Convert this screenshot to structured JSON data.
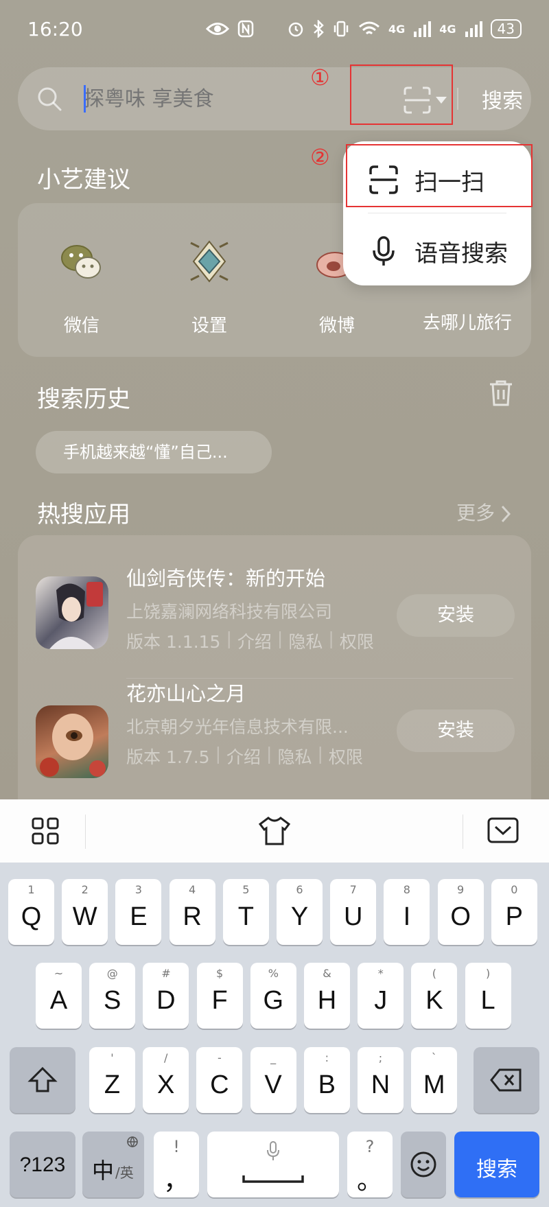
{
  "status_bar": {
    "time": "16:20",
    "network_1": "4G",
    "network_2": "4G",
    "battery": "43"
  },
  "search": {
    "placeholder": "探粤味 享美食",
    "button_label": "搜索"
  },
  "annotations": {
    "marker_1": "①",
    "marker_2": "②",
    "highlight_color": "#e53333"
  },
  "popup_menu": {
    "items": [
      {
        "label": "扫一扫",
        "icon": "scan-icon"
      },
      {
        "label": "语音搜索",
        "icon": "microphone-icon"
      }
    ]
  },
  "suggestions": {
    "title": "小艺建议",
    "apps": [
      {
        "label": "微信",
        "icon": "wechat-icon"
      },
      {
        "label": "设置",
        "icon": "settings-icon"
      },
      {
        "label": "微博",
        "icon": "weibo-icon"
      },
      {
        "label": "去哪儿旅行",
        "icon": "qunar-icon"
      }
    ]
  },
  "history": {
    "title": "搜索历史",
    "items": [
      "手机越来越“懂”自己..."
    ]
  },
  "hot_apps": {
    "title": "热搜应用",
    "more_label": "更多",
    "apps": [
      {
        "name": "仙剑奇侠传：新的开始",
        "company": "上饶嘉澜网络科技有限公司",
        "version": "版本 1.1.15",
        "intro": "介绍",
        "privacy": "隐私",
        "permissions": "权限",
        "install_label": "安装"
      },
      {
        "name": "花亦山心之月",
        "company": "北京朝夕光年信息技术有限...",
        "version": "版本 1.7.5",
        "intro": "介绍",
        "privacy": "隐私",
        "permissions": "权限",
        "install_label": "安装"
      }
    ]
  },
  "keyboard": {
    "row1": [
      {
        "k": "Q",
        "h": "1"
      },
      {
        "k": "W",
        "h": "2"
      },
      {
        "k": "E",
        "h": "3"
      },
      {
        "k": "R",
        "h": "4"
      },
      {
        "k": "T",
        "h": "5"
      },
      {
        "k": "Y",
        "h": "6"
      },
      {
        "k": "U",
        "h": "7"
      },
      {
        "k": "I",
        "h": "8"
      },
      {
        "k": "O",
        "h": "9"
      },
      {
        "k": "P",
        "h": "0"
      }
    ],
    "row2": [
      {
        "k": "A",
        "h": "~"
      },
      {
        "k": "S",
        "h": "@"
      },
      {
        "k": "D",
        "h": "#"
      },
      {
        "k": "F",
        "h": "$"
      },
      {
        "k": "G",
        "h": "%"
      },
      {
        "k": "H",
        "h": "&"
      },
      {
        "k": "J",
        "h": "*"
      },
      {
        "k": "K",
        "h": "("
      },
      {
        "k": "L",
        "h": ")"
      }
    ],
    "row3": [
      {
        "k": "Z",
        "h": "'"
      },
      {
        "k": "X",
        "h": "/"
      },
      {
        "k": "C",
        "h": "-"
      },
      {
        "k": "V",
        "h": "_"
      },
      {
        "k": "B",
        "h": ":"
      },
      {
        "k": "N",
        "h": ";"
      },
      {
        "k": "M",
        "h": "`"
      }
    ],
    "num_key": "?123",
    "lang_main": "中",
    "lang_sub": "/英",
    "comma": "，",
    "comma_hint": "!",
    "period": "。",
    "period_hint": "?",
    "enter_label": "搜索"
  }
}
